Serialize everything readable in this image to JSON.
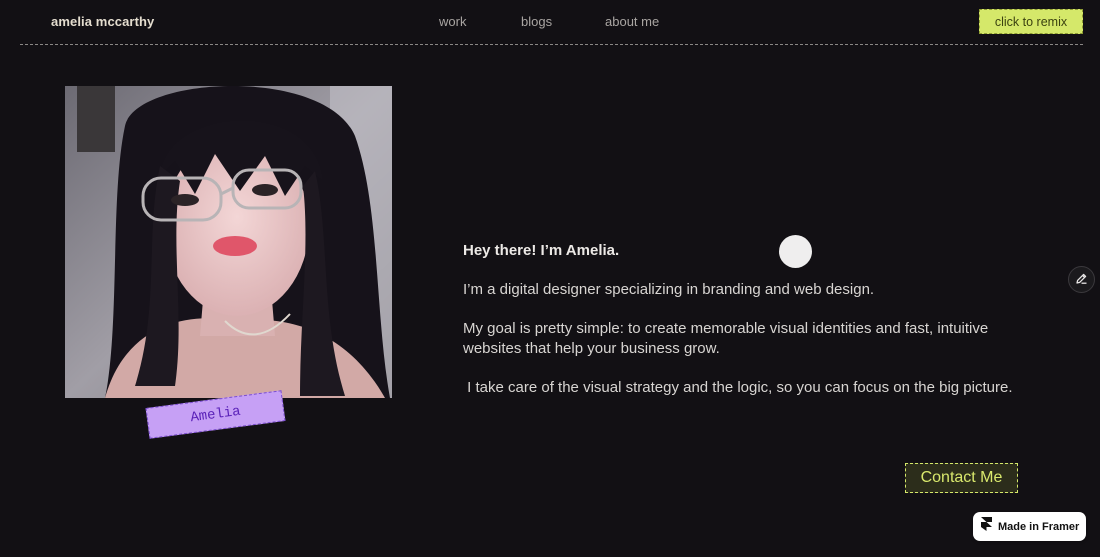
{
  "header": {
    "brand": "amelia mccarthy",
    "nav": [
      {
        "label": "work"
      },
      {
        "label": "blogs"
      },
      {
        "label": "about me"
      }
    ],
    "remix_label": "click to remix"
  },
  "profile": {
    "name_tag": "Amelia"
  },
  "bio": {
    "heading": "Hey there! I’m Amelia.",
    "paragraphs": [
      "I’m a digital designer specializing in branding and web design.",
      "My goal is pretty simple: to create memorable visual identities and fast, intuitive websites that help your business grow.",
      " I take care of the visual strategy and the logic, so you can focus on the big picture."
    ]
  },
  "contact_label": "Contact Me",
  "badge": {
    "label": "Made in Framer",
    "icon": "framer-logo-icon"
  },
  "icons": {
    "edit": "pencil-icon"
  },
  "colors": {
    "background": "#121014",
    "accent": "#d5e86a",
    "tag": "#c6a0f5",
    "tag_text": "#5a21b8"
  }
}
